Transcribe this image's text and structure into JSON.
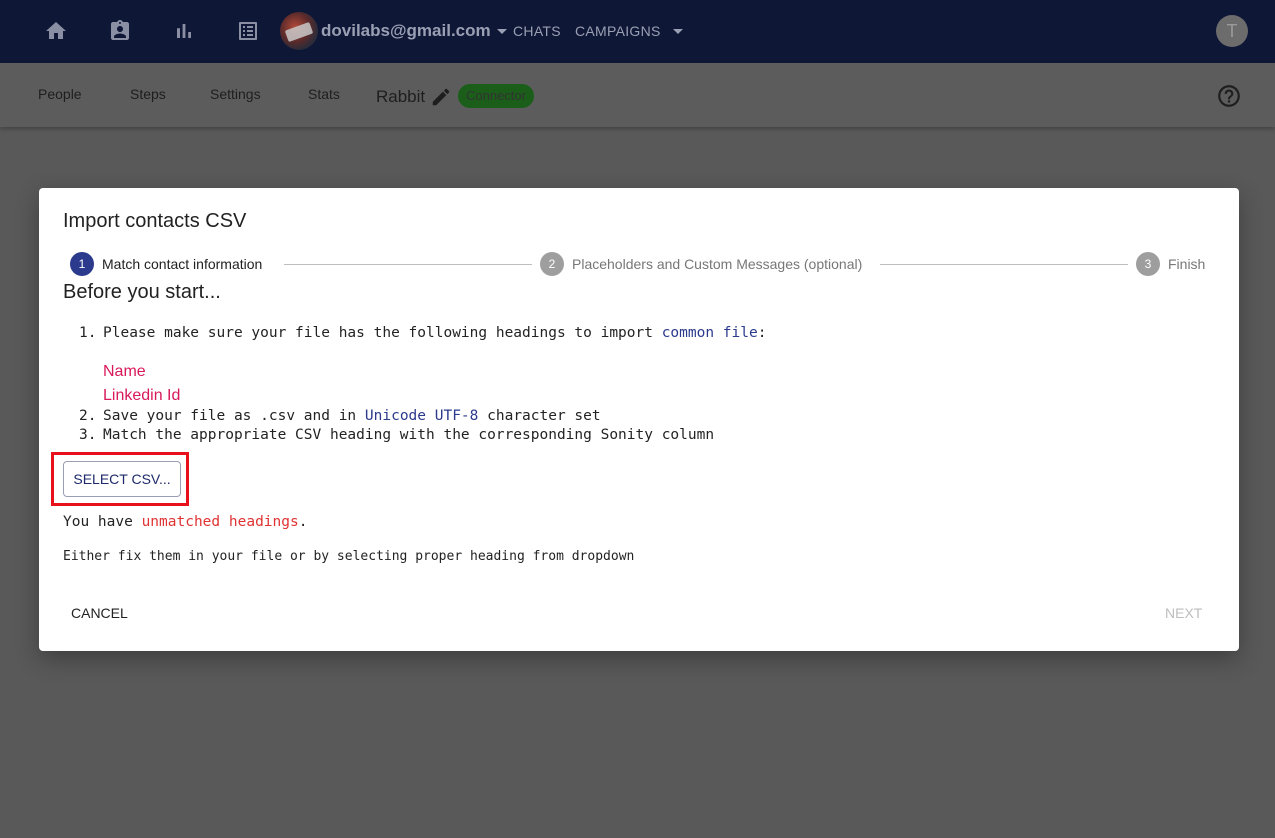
{
  "topbar": {
    "icons": [
      "home-icon",
      "contact-card-icon",
      "bar-chart-icon",
      "list-icon"
    ],
    "account_email": "dovilabs@gmail.com",
    "links": {
      "chats": "CHATS",
      "campaigns": "CAMPAIGNS"
    },
    "user_initial": "T"
  },
  "subbar": {
    "tabs": {
      "people": "People",
      "steps": "Steps",
      "settings": "Settings",
      "stats": "Stats"
    },
    "campaign_name": "Rabbit",
    "badge": "Connector"
  },
  "modal": {
    "title": "Import contacts CSV",
    "steps": [
      {
        "number": "1",
        "label": "Match contact information",
        "active": true
      },
      {
        "number": "2",
        "label": "Placeholders and Custom Messages (optional)",
        "active": false
      },
      {
        "number": "3",
        "label": "Finish",
        "active": false
      }
    ],
    "section_title": "Before you start...",
    "instructions": {
      "item1_num": "1.",
      "item1_prefix": "Please make sure your file has the following headings to import ",
      "item1_link": "common file",
      "item1_suffix": ":",
      "headings": [
        "Name",
        "Linkedin Id"
      ],
      "item2_num": "2.",
      "item2_prefix": "Save your file as .csv and in ",
      "item2_link": "Unicode UTF-8",
      "item2_suffix": " character set",
      "item3_num": "3.",
      "item3_text": "Match the appropriate CSV heading with the corresponding Sonity column"
    },
    "select_button": "SELECT CSV...",
    "unmatched_prefix": "You have ",
    "unmatched_link": "unmatched headings",
    "unmatched_suffix": ".",
    "fix_hint": "Either fix them in your file or by selecting proper heading from dropdown",
    "cancel_label": "CANCEL",
    "next_label": "NEXT"
  },
  "colors": {
    "topbar_bg": "#0e1736",
    "overlay_bg": "#595959",
    "step_active": "#2b3a8c",
    "step_inactive": "#9e9e9e",
    "heading_pink": "#d8195a",
    "error_red": "#e03232",
    "highlight_red": "#e8101a",
    "badge_green": "#1a5e1a"
  }
}
